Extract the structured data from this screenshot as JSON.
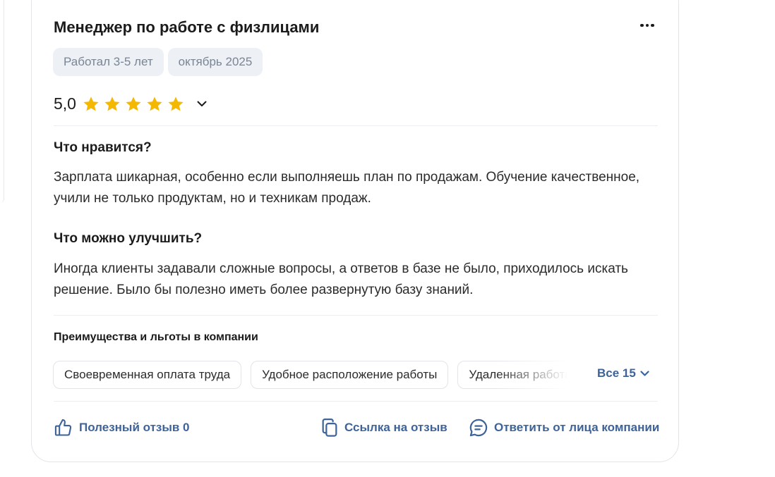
{
  "review": {
    "title": "Менеджер по работе с физлицами",
    "tags": [
      "Работал 3-5 лет",
      "октябрь 2025"
    ],
    "rating": {
      "value": "5,0",
      "stars": 5,
      "max": 5
    },
    "likes": {
      "title": "Что нравится?",
      "text": "Зарплата шикарная, особенно если выполняешь план по продажам. Обучение качественное, учили не только продуктам, но и техникам продаж."
    },
    "improve": {
      "title": "Что можно улучшить?",
      "text": "Иногда клиенты задавали сложные вопросы, а ответов в базе не было, приходилось искать решение. Было бы полезно иметь более развернутую базу знаний."
    }
  },
  "perks": {
    "title": "Преимущества и льготы в компании",
    "items": [
      "Своевременная оплата труда",
      "Удобное расположение работы",
      "Удаленная работа"
    ],
    "all_label": "Все 15"
  },
  "actions": {
    "helpful": "Полезный отзыв 0",
    "link": "Ссылка на отзыв",
    "reply": "Ответить от лица компании"
  },
  "colors": {
    "accent": "#3d6399",
    "star": "#f5b800",
    "tag_bg": "#edf0f5",
    "tag_text": "#7b8593"
  },
  "icons": [
    "more-icon",
    "star-icon",
    "chevron-down-icon",
    "thumbs-up-icon",
    "copy-link-icon",
    "chat-bubble-icon"
  ]
}
